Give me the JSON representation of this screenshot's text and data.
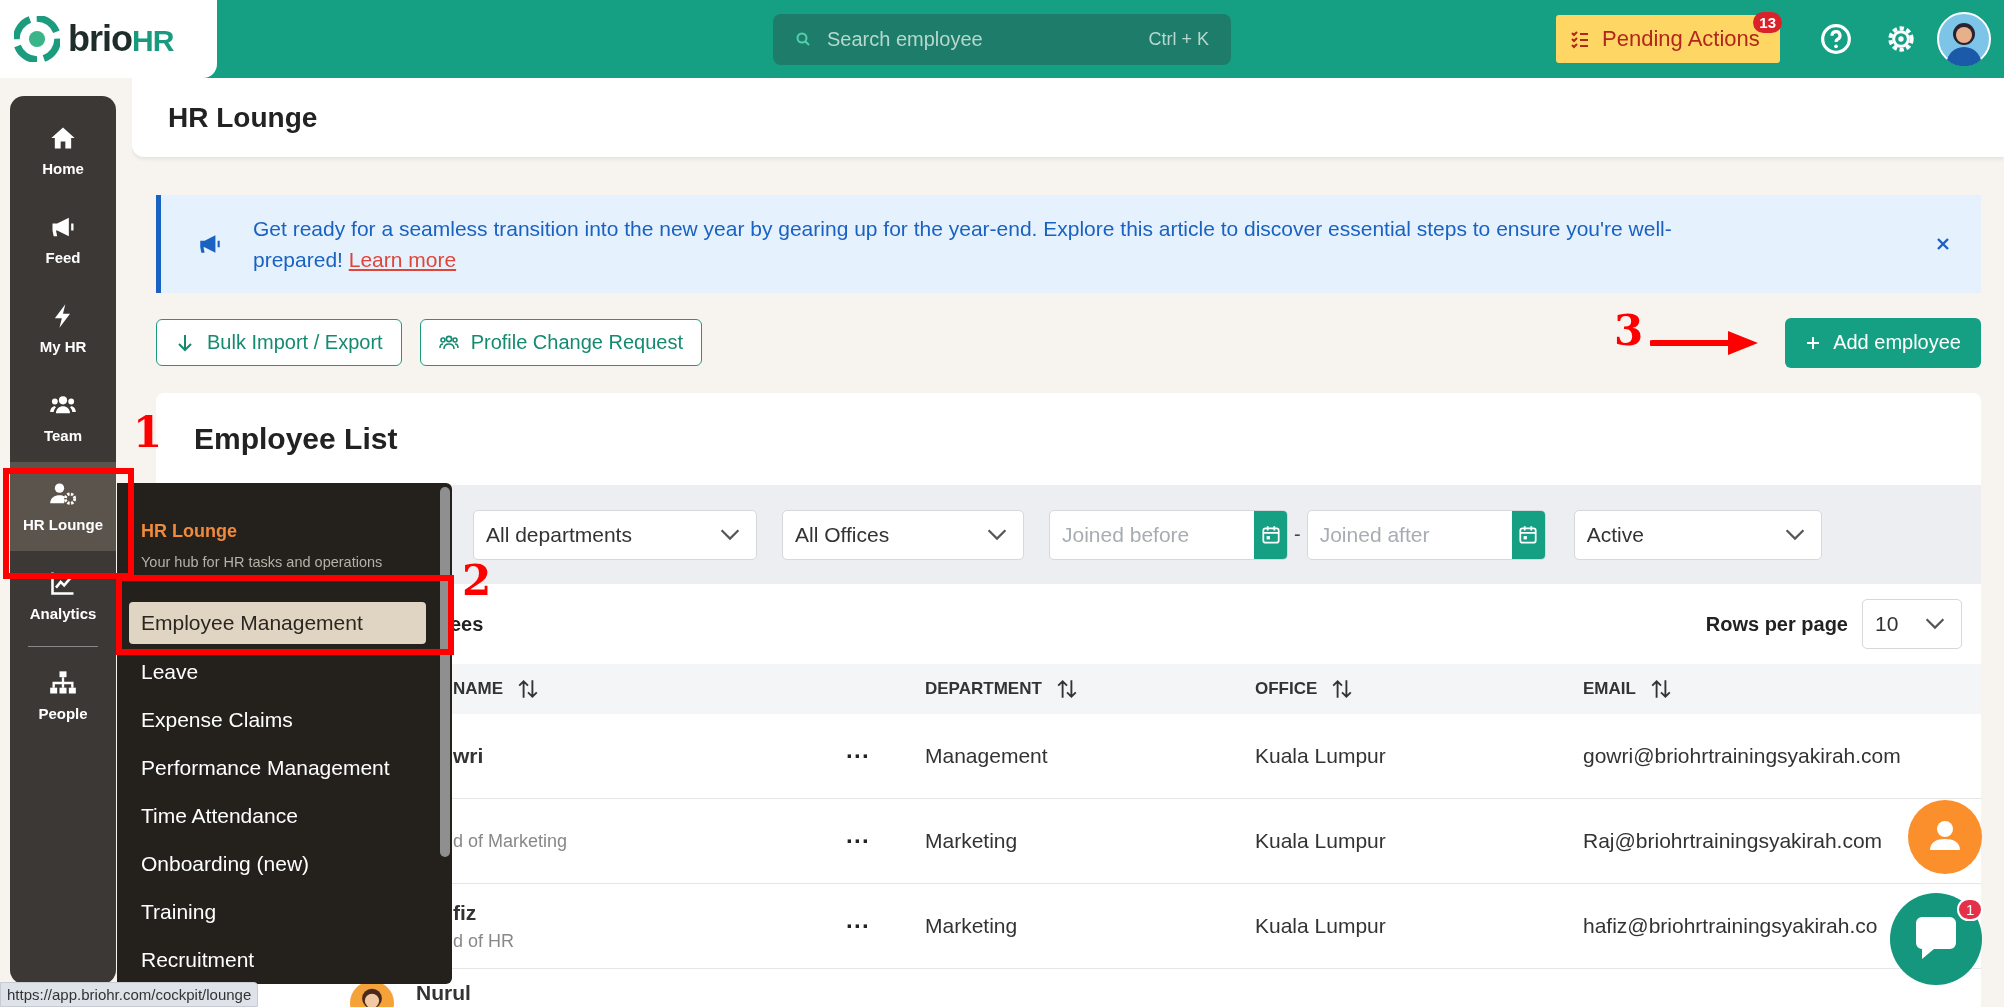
{
  "topbar": {
    "logo": {
      "brand": "brio",
      "suffix": "HR"
    },
    "search": {
      "placeholder": "Search employee",
      "shortcut": "Ctrl + K"
    },
    "pending": {
      "label": "Pending Actions",
      "count": "13"
    }
  },
  "sidebar": {
    "items": [
      {
        "label": "Home",
        "selected": false
      },
      {
        "label": "Feed",
        "selected": false
      },
      {
        "label": "My HR",
        "selected": false
      },
      {
        "label": "Team",
        "selected": false
      },
      {
        "label": "HR Lounge",
        "selected": true
      },
      {
        "label": "Analytics",
        "selected": false
      },
      {
        "label": "People",
        "selected": false
      }
    ]
  },
  "page_title": "HR Lounge",
  "banner": {
    "text": "Get ready for a seamless transition into the new year by gearing up for the year-end. Explore this article to discover essential steps to ensure you're well-prepared!",
    "link": "Learn more"
  },
  "actions": [
    {
      "label": "Bulk Import / Export"
    },
    {
      "label": "Profile Change Request"
    }
  ],
  "add_button": "Add employee",
  "employee_list": {
    "title": "Employee List",
    "filters": [
      {
        "kind": "select",
        "value": "All departments"
      },
      {
        "kind": "select",
        "value": "All Offices"
      },
      {
        "kind": "date",
        "placeholder": "Joined before"
      },
      {
        "kind": "dash",
        "text": "-"
      },
      {
        "kind": "date",
        "placeholder": "Joined after"
      },
      {
        "kind": "select",
        "value": "Active"
      }
    ],
    "count_label": "ees",
    "rows_per_page": {
      "label": "Rows per page",
      "value": "10"
    },
    "columns": [
      {
        "label": "NAME"
      },
      {
        "label": "DEPARTMENT"
      },
      {
        "label": "OFFICE"
      },
      {
        "label": "EMAIL"
      }
    ],
    "rows": [
      {
        "name": "wri",
        "title": "",
        "kind": "covered",
        "more": "···",
        "department": "Management",
        "office": "Kuala Lumpur",
        "email": "gowri@briohrtrainingsyakirah.com"
      },
      {
        "name": "",
        "title": "d of Marketing",
        "kind": "covered",
        "more": "···",
        "department": "Marketing",
        "office": "Kuala Lumpur",
        "email": "Raj@briohrtrainingsyakirah.com"
      },
      {
        "name": "fiz",
        "title": "d of HR",
        "kind": "covered",
        "more": "···",
        "department": "Marketing",
        "office": "Kuala Lumpur",
        "email": "hafiz@briohrtrainingsyakirah.co"
      },
      {
        "name": "Nurul",
        "title": "",
        "kind": "person",
        "more": "",
        "department": "",
        "office": "",
        "email": ""
      }
    ]
  },
  "flyout": {
    "title": "HR Lounge",
    "subtitle": "Your hub for HR tasks and operations",
    "items": [
      {
        "label": "Employee Management",
        "selected": true
      },
      {
        "label": "Leave",
        "selected": false
      },
      {
        "label": "Expense Claims",
        "selected": false
      },
      {
        "label": "Performance Management",
        "selected": false
      },
      {
        "label": "Time Attendance",
        "selected": false
      },
      {
        "label": "Onboarding (new)",
        "selected": false
      },
      {
        "label": "Training",
        "selected": false
      },
      {
        "label": "Recruitment",
        "selected": false
      }
    ]
  },
  "annotations": [
    {
      "label": "1"
    },
    {
      "label": "2"
    },
    {
      "label": "3"
    }
  ],
  "chat_badge": "1",
  "status_url": "https://app.briohr.com/cockpit/lounge"
}
